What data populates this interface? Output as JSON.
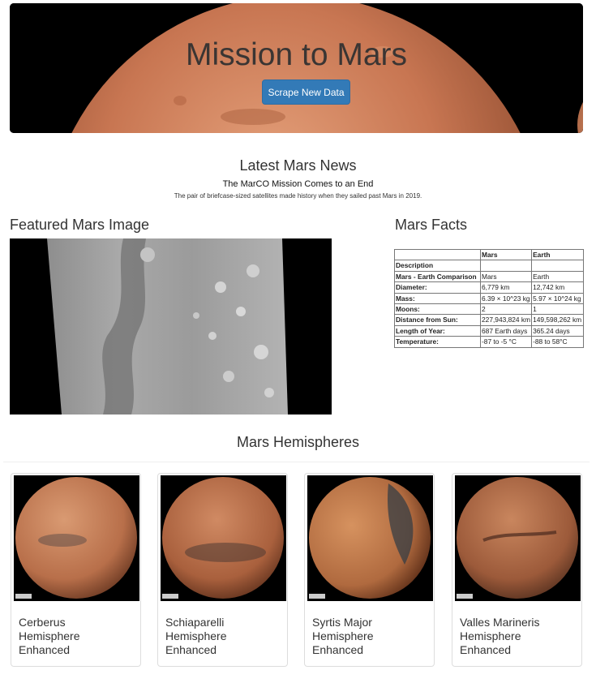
{
  "header": {
    "title": "Mission to Mars",
    "scrape_button": "Scrape New Data"
  },
  "news": {
    "heading": "Latest Mars News",
    "title": "The MarCO Mission Comes to an End",
    "teaser": "The pair of briefcase-sized satellites made history when they sailed past Mars in 2019."
  },
  "featured": {
    "heading": "Featured Mars Image"
  },
  "facts": {
    "heading": "Mars Facts",
    "columns": [
      "",
      "Mars",
      "Earth"
    ],
    "index_label": "Description",
    "rows": [
      [
        "Mars - Earth Comparison",
        "Mars",
        "Earth"
      ],
      [
        "Diameter:",
        "6,779 km",
        "12,742 km"
      ],
      [
        "Mass:",
        "6.39 × 10^23 kg",
        "5.97 × 10^24 kg"
      ],
      [
        "Moons:",
        "2",
        "1"
      ],
      [
        "Distance from Sun:",
        "227,943,824 km",
        "149,598,262 km"
      ],
      [
        "Length of Year:",
        "687 Earth days",
        "365.24 days"
      ],
      [
        "Temperature:",
        "-87 to -5 °C",
        "-88 to 58°C"
      ]
    ]
  },
  "hemispheres": {
    "heading": "Mars Hemispheres",
    "items": [
      {
        "title_line1": "Cerberus",
        "title_line2": "Hemisphere",
        "title_line3": "Enhanced"
      },
      {
        "title_line1": "Schiaparelli",
        "title_line2": "Hemisphere",
        "title_line3": "Enhanced"
      },
      {
        "title_line1": "Syrtis Major",
        "title_line2": "Hemisphere",
        "title_line3": "Enhanced"
      },
      {
        "title_line1": "Valles Marineris",
        "title_line2": "Hemisphere",
        "title_line3": "Enhanced"
      }
    ]
  },
  "colors": {
    "button_blue": "#337ab7",
    "mars_orange": "#c0714a",
    "mars_dark": "#6b3a25"
  }
}
